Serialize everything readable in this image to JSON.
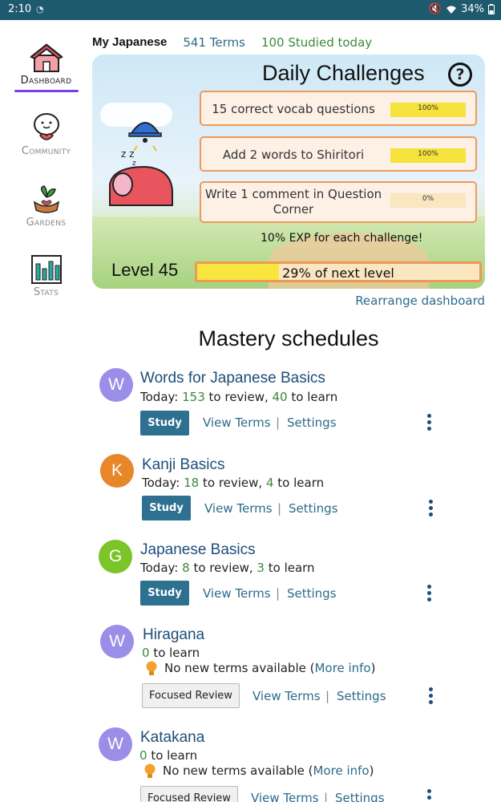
{
  "status_bar": {
    "time": "2:10",
    "battery": "34%"
  },
  "sidebar": {
    "items": [
      {
        "label": "Dashboard",
        "active": true,
        "icon": "house-icon"
      },
      {
        "label": "Community",
        "active": false,
        "icon": "speech-bubble-icon"
      },
      {
        "label": "Gardens",
        "active": false,
        "icon": "sprout-heart-icon"
      },
      {
        "label": "Stats",
        "active": false,
        "icon": "bar-chart-icon"
      }
    ]
  },
  "header": {
    "course": "My Japanese",
    "terms": "541 Terms",
    "studied": "100 Studied today"
  },
  "challenges": {
    "title": "Daily Challenges",
    "help": "?",
    "items": [
      {
        "text": "15 correct vocab questions",
        "progress": "100%",
        "value": 1.0
      },
      {
        "text": "Add 2 words to Shiritori",
        "progress": "100%",
        "value": 1.0
      },
      {
        "text": "Write 1 comment in Question Corner",
        "progress": "0%",
        "value": 0.0
      }
    ],
    "exp_note": "10% EXP for each challenge!",
    "level": "Level 45",
    "level_progress_text": "29% of next level",
    "level_progress": 0.29
  },
  "rearrange": "Rearrange dashboard",
  "section_title": "Mastery schedules",
  "schedules": [
    {
      "initial": "W",
      "color": "#9b8ee8",
      "title": "Words for Japanese Basics",
      "today": "Today: ",
      "review": "153",
      "review_suffix": " to review, ",
      "learn": "40",
      "learn_suffix": " to learn",
      "button": "Study",
      "view_terms": "View Terms",
      "settings": "Settings",
      "separator": "|"
    },
    {
      "initial": "K",
      "color": "#e8862a",
      "title": "Kanji Basics",
      "today": "Today: ",
      "review": "18",
      "review_suffix": " to review, ",
      "learn": "4",
      "learn_suffix": " to learn",
      "button": "Study",
      "view_terms": "View Terms",
      "settings": "Settings",
      "separator": "|"
    },
    {
      "initial": "G",
      "color": "#7bc42a",
      "title": "Japanese Basics",
      "today": "Today: ",
      "review": "8",
      "review_suffix": " to review, ",
      "learn": "3",
      "learn_suffix": " to learn",
      "button": "Study",
      "view_terms": "View Terms",
      "settings": "Settings",
      "separator": "|"
    },
    {
      "initial": "W",
      "color": "#9b8ee8",
      "title": "Hiragana",
      "learn": "0",
      "learn_suffix": " to learn",
      "info": "No new terms available (",
      "more_info": "More info",
      "info_close": ")",
      "button": "Focused Review",
      "view_terms": "View Terms",
      "settings": "Settings",
      "separator": "|"
    },
    {
      "initial": "W",
      "color": "#9b8ee8",
      "title": "Katakana",
      "learn": "0",
      "learn_suffix": " to learn",
      "info": "No new terms available (",
      "more_info": "More info",
      "info_close": ")",
      "button": "Focused Review",
      "view_terms": "View Terms",
      "settings": "Settings",
      "separator": "|"
    }
  ]
}
